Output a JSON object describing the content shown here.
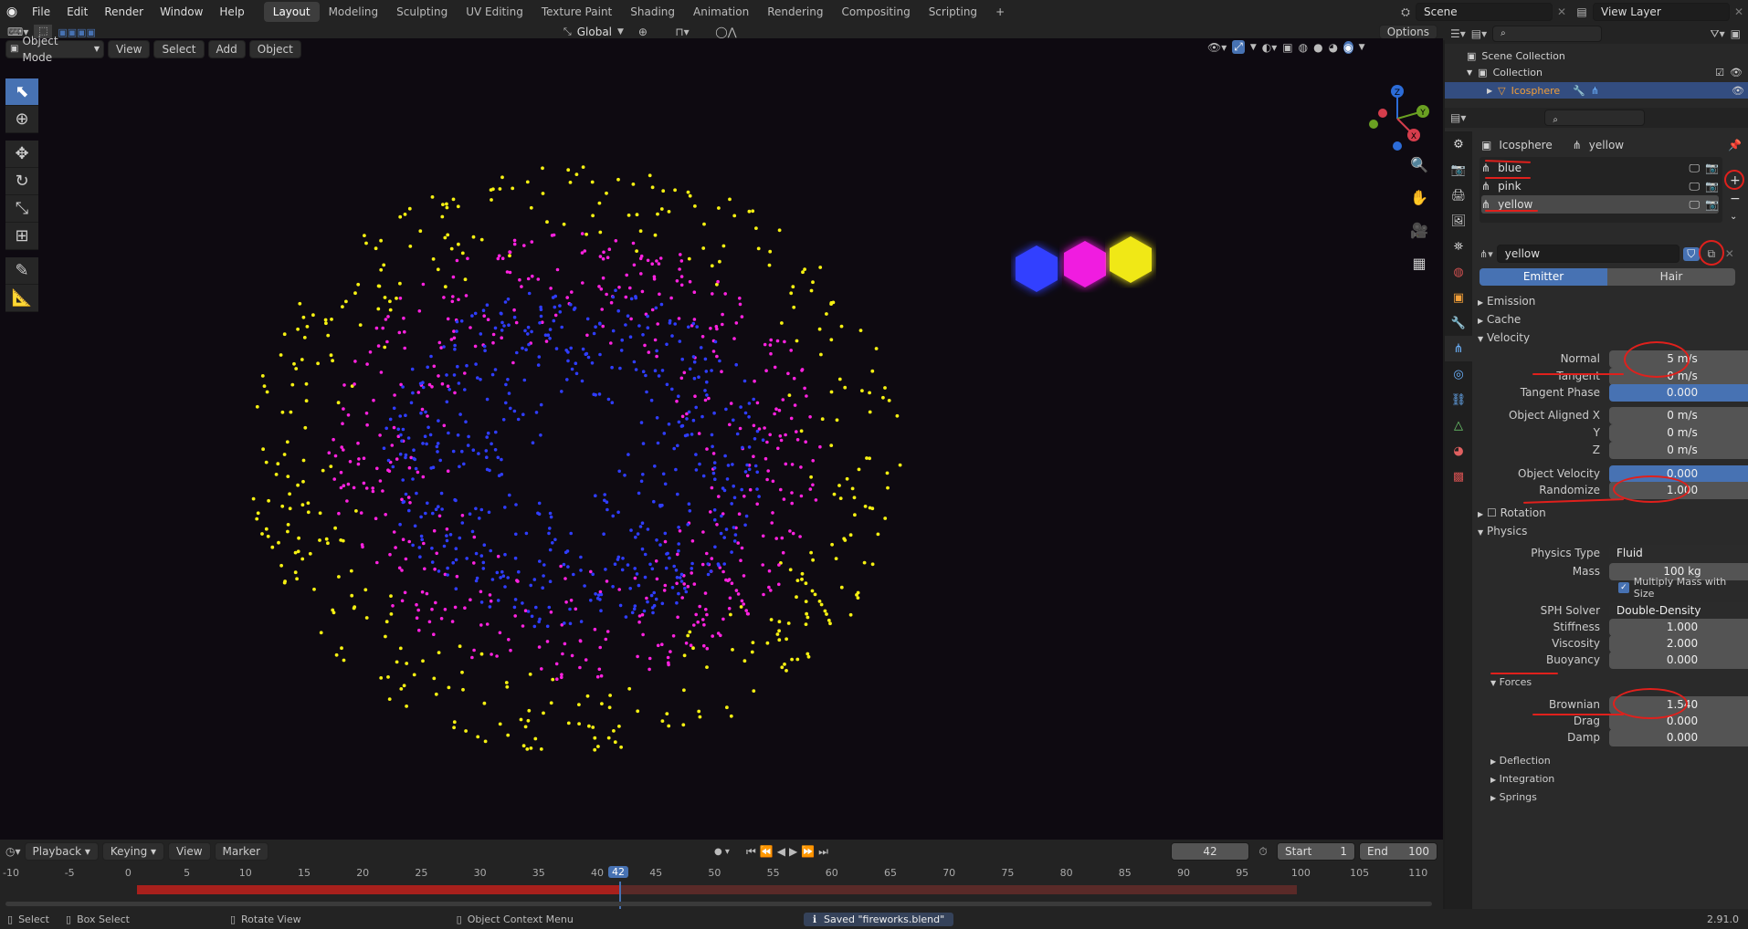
{
  "topbar": {
    "menus": [
      "File",
      "Edit",
      "Render",
      "Window",
      "Help"
    ],
    "workspaces": [
      "Layout",
      "Modeling",
      "Sculpting",
      "UV Editing",
      "Texture Paint",
      "Shading",
      "Animation",
      "Rendering",
      "Compositing",
      "Scripting"
    ],
    "active_workspace": "Layout",
    "add_tab": "+",
    "scene": "Scene",
    "view_layer": "View Layer"
  },
  "header2": {
    "orientation": "Global",
    "options": "Options"
  },
  "viewport_header": {
    "mode": "Object Mode",
    "menus": [
      "View",
      "Select",
      "Add",
      "Object"
    ]
  },
  "outliner": {
    "scene_collection": "Scene Collection",
    "collection": "Collection",
    "object": "Icosphere"
  },
  "properties": {
    "object_name": "Icosphere",
    "psys_name": "yellow",
    "systems": [
      "blue",
      "pink",
      "yellow"
    ],
    "settings_name": "yellow",
    "tabs": [
      "Emitter",
      "Hair"
    ],
    "active_tab": "Emitter",
    "sections": {
      "emission": "Emission",
      "cache": "Cache",
      "velocity": "Velocity",
      "rotation": "Rotation",
      "physics": "Physics",
      "forces": "Forces",
      "deflection": "Deflection",
      "integration": "Integration",
      "springs": "Springs"
    },
    "velocity": [
      {
        "label": "Normal",
        "value": "5 m/s"
      },
      {
        "label": "Tangent",
        "value": "0 m/s"
      },
      {
        "label": "Tangent Phase",
        "value": "0.000"
      },
      {
        "label": "Object Aligned X",
        "value": "0 m/s"
      },
      {
        "label": "Y",
        "value": "0 m/s"
      },
      {
        "label": "Z",
        "value": "0 m/s"
      },
      {
        "label": "Object Velocity",
        "value": "0.000"
      },
      {
        "label": "Randomize",
        "value": "1.000"
      }
    ],
    "physics": {
      "physics_type_label": "Physics Type",
      "physics_type": "Fluid",
      "mass_label": "Mass",
      "mass": "100 kg",
      "multiply_mass": "Multiply Mass with Size",
      "sph_label": "SPH Solver",
      "sph": "Double-Density",
      "stiffness_label": "Stiffness",
      "stiffness": "1.000",
      "viscosity_label": "Viscosity",
      "viscosity": "2.000",
      "buoyancy_label": "Buoyancy",
      "buoyancy": "0.000"
    },
    "forces": [
      {
        "label": "Brownian",
        "value": "1.540"
      },
      {
        "label": "Drag",
        "value": "0.000"
      },
      {
        "label": "Damp",
        "value": "0.000"
      }
    ]
  },
  "timeline": {
    "menus": [
      "Playback",
      "Keying",
      "View",
      "Marker"
    ],
    "current_frame": "42",
    "start_label": "Start",
    "start": "1",
    "end_label": "End",
    "end": "100",
    "ticks": [
      "-10",
      "-5",
      "0",
      "5",
      "10",
      "15",
      "20",
      "25",
      "30",
      "35",
      "40",
      "45",
      "50",
      "55",
      "60",
      "65",
      "70",
      "75",
      "80",
      "85",
      "90",
      "95",
      "100",
      "105",
      "110"
    ]
  },
  "statusbar": {
    "select": "Select",
    "box_select": "Box Select",
    "rotate_view": "Rotate View",
    "context_menu": "Object Context Menu",
    "message": "Saved \"fireworks.blend\"",
    "version": "2.91.0"
  },
  "colors": {
    "accent": "#4772b3",
    "annotation": "#e0201c",
    "blue_particle": "#2f3dff",
    "pink_particle": "#ff22e0",
    "yellow_particle": "#f5f012",
    "frame_range": "#a8201c"
  }
}
